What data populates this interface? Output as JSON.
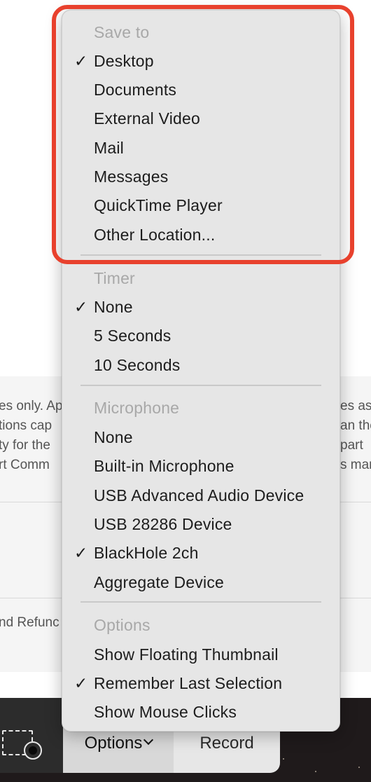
{
  "background": {
    "fragments": {
      "left_1": "es only. Ap",
      "left_2": "tions cap",
      "left_3": "ty for the",
      "left_4": "rt Comm",
      "left_5": "nd Refunc",
      "right_1": "es as",
      "right_2": "an the",
      "right_3": "part",
      "right_4": "s mar"
    }
  },
  "menu": {
    "save_to": {
      "header": "Save to",
      "items": [
        {
          "label": "Desktop",
          "checked": true
        },
        {
          "label": "Documents",
          "checked": false
        },
        {
          "label": "External Video",
          "checked": false
        },
        {
          "label": "Mail",
          "checked": false
        },
        {
          "label": "Messages",
          "checked": false
        },
        {
          "label": "QuickTime Player",
          "checked": false
        },
        {
          "label": "Other Location...",
          "checked": false
        }
      ]
    },
    "timer": {
      "header": "Timer",
      "items": [
        {
          "label": "None",
          "checked": true
        },
        {
          "label": "5 Seconds",
          "checked": false
        },
        {
          "label": "10 Seconds",
          "checked": false
        }
      ]
    },
    "microphone": {
      "header": "Microphone",
      "items": [
        {
          "label": "None",
          "checked": false
        },
        {
          "label": "Built-in Microphone",
          "checked": false
        },
        {
          "label": "USB Advanced Audio Device",
          "checked": false
        },
        {
          "label": "USB 28286 Device",
          "checked": false
        },
        {
          "label": "BlackHole 2ch",
          "checked": true
        },
        {
          "label": "Aggregate Device",
          "checked": false
        }
      ]
    },
    "options": {
      "header": "Options",
      "items": [
        {
          "label": "Show Floating Thumbnail",
          "checked": false
        },
        {
          "label": "Remember Last Selection",
          "checked": true
        },
        {
          "label": "Show Mouse Clicks",
          "checked": false
        }
      ]
    },
    "check_glyph": "✓"
  },
  "toolbar": {
    "options_label": "Options",
    "record_label": "Record",
    "capture_icon": "capture-selected-portion-icon"
  },
  "highlight_color": "#e8412d"
}
